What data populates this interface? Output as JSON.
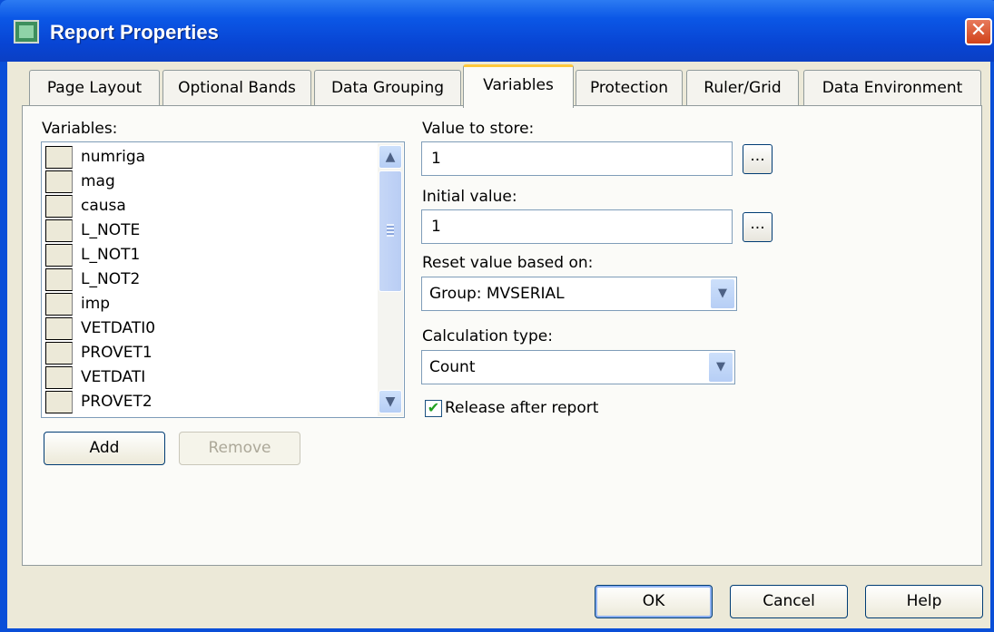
{
  "window": {
    "title": "Report Properties",
    "close_symbol": "✕"
  },
  "tabs": [
    {
      "label": "Page Layout"
    },
    {
      "label": "Optional Bands"
    },
    {
      "label": "Data Grouping"
    },
    {
      "label": "Variables",
      "active": true
    },
    {
      "label": "Protection"
    },
    {
      "label": "Ruler/Grid"
    },
    {
      "label": "Data Environment"
    }
  ],
  "variables": {
    "label": "Variables:",
    "items": [
      "numriga",
      "mag",
      "causa",
      "L_NOTE",
      "L_NOT1",
      "L_NOT2",
      "imp",
      "VETDATI0",
      "PROVET1",
      "VETDATI",
      "PROVET2"
    ],
    "add_label": "Add",
    "remove_label": "Remove"
  },
  "value_to_store": {
    "label": "Value to store:",
    "value": "1",
    "button_label": "..."
  },
  "initial_value": {
    "label": "Initial value:",
    "value": "1",
    "button_label": "..."
  },
  "reset_based_on": {
    "label": "Reset value based on:",
    "value": "Group: MVSERIAL"
  },
  "calculation_type": {
    "label": "Calculation type:",
    "value": "Count"
  },
  "release_after_report": {
    "label": "Release after report",
    "checked": true,
    "check_symbol": "✔"
  },
  "scroll": {
    "up_symbol": "▲",
    "down_symbol": "▼"
  },
  "combo_arrow_symbol": "▼",
  "footer": {
    "ok_label": "OK",
    "cancel_label": "Cancel",
    "help_label": "Help"
  },
  "colors": {
    "titlebar": "#0a4fd8",
    "dialog_bg": "#ece9d8",
    "active_tab_accent": "#ffc83c"
  }
}
